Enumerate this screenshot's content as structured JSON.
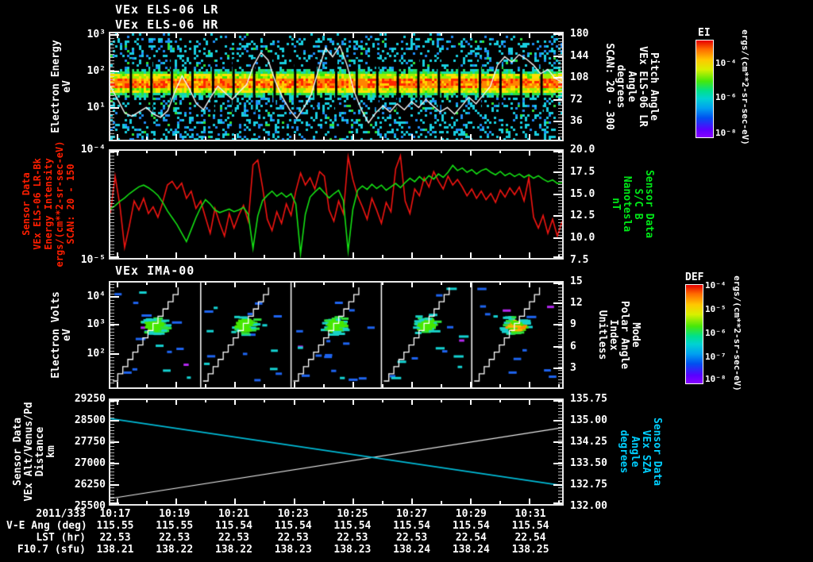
{
  "titles": {
    "line1": "VEx ELS-06 LR",
    "line2": "VEx ELS-06 HR",
    "panel3": "VEx IMA-00"
  },
  "colors": {
    "red_label": "#ff1e00",
    "green_label": "#00e818",
    "cyan_label": "#00cfff",
    "white": "#ffffff",
    "red_line": "#f01410",
    "green_line": "#14e014",
    "sza_line": "#00bcd8",
    "dist_line": "#f0f0f0"
  },
  "time_axis": {
    "date_label": "2011/333",
    "ticks": [
      "10:17",
      "10:19",
      "10:21",
      "10:23",
      "10:25",
      "10:27",
      "10:29",
      "10:31"
    ],
    "tick_fracs": [
      0.014,
      0.1444,
      0.2748,
      0.4052,
      0.5356,
      0.666,
      0.7964,
      0.9268
    ]
  },
  "panel1": {
    "left_axis": {
      "label_lines": [
        "Electron Energy",
        "eV"
      ],
      "ticks": [
        {
          "label": "10³",
          "frac": 0.022
        },
        {
          "label": "10²",
          "frac": 0.355
        },
        {
          "label": "10¹",
          "frac": 0.688
        }
      ]
    },
    "right_axis": {
      "label_lines": [
        "Pitch Angle",
        "VEx ELS-06 LR",
        "Angle",
        "degrees",
        "SCAN: 20 - 300"
      ],
      "ticks": [
        {
          "label": "180",
          "frac": 0.015
        },
        {
          "label": "144",
          "frac": 0.217
        },
        {
          "label": "108",
          "frac": 0.413
        },
        {
          "label": "72",
          "frac": 0.616
        },
        {
          "label": "36",
          "frac": 0.812
        }
      ]
    }
  },
  "panel2": {
    "left_axis": {
      "label_lines": [
        "Sensor Data",
        "VEx ELS-06 LR-Bk",
        "Energy Intensity",
        "ergs/(cm**2-sr-sec-eV)",
        "SCAN: 20 - 150"
      ],
      "ticks": [
        {
          "label": "10⁻⁴",
          "frac": 0.0
        },
        {
          "label": "10⁻⁵",
          "frac": 1.0
        }
      ]
    },
    "right_axis": {
      "label_lines": [
        "Sensor Data",
        "S/C B",
        "Nanotesla",
        "nT"
      ],
      "ticks": [
        {
          "label": "20.0",
          "frac": 0.0
        },
        {
          "label": "17.5",
          "frac": 0.2
        },
        {
          "label": "15.0",
          "frac": 0.4
        },
        {
          "label": "12.5",
          "frac": 0.6
        },
        {
          "label": "10.0",
          "frac": 0.8
        },
        {
          "label": "7.5",
          "frac": 1.0
        }
      ]
    }
  },
  "panel3": {
    "left_axis": {
      "label_lines": [
        "Electron Volts",
        "eV"
      ],
      "ticks": [
        {
          "label": "10⁴",
          "frac": 0.14
        },
        {
          "label": "10³",
          "frac": 0.4
        },
        {
          "label": "10²",
          "frac": 0.67
        }
      ]
    },
    "right_axis": {
      "label_lines": [
        "Mode",
        "Polar Angle",
        "Index",
        "Unitless"
      ],
      "ticks": [
        {
          "label": "15",
          "frac": 0.0
        },
        {
          "label": "12",
          "frac": 0.2
        },
        {
          "label": "9",
          "frac": 0.4
        },
        {
          "label": "6",
          "frac": 0.6
        },
        {
          "label": "3",
          "frac": 0.8
        }
      ]
    }
  },
  "panel4": {
    "left_axis": {
      "label_lines": [
        "Sensor Data",
        "VEx Alt/Venus/Pd",
        "Distance",
        "km"
      ],
      "ticks": [
        {
          "label": "29250",
          "frac": 0.0
        },
        {
          "label": "28500",
          "frac": 0.2
        },
        {
          "label": "27750",
          "frac": 0.4
        },
        {
          "label": "27000",
          "frac": 0.6
        },
        {
          "label": "26250",
          "frac": 0.8
        },
        {
          "label": "25500",
          "frac": 1.0
        }
      ]
    },
    "right_axis": {
      "label_lines": [
        "Sensor Data",
        "VEx SZA",
        "Angle",
        "degrees"
      ],
      "ticks": [
        {
          "label": "135.75",
          "frac": 0.0
        },
        {
          "label": "135.00",
          "frac": 0.2
        },
        {
          "label": "134.25",
          "frac": 0.4
        },
        {
          "label": "133.50",
          "frac": 0.6
        },
        {
          "label": "132.75",
          "frac": 0.8
        },
        {
          "label": "132.00",
          "frac": 1.0
        }
      ]
    }
  },
  "colorbars": [
    {
      "title": "EI",
      "unit": "ergs/(cm**2-sr-sec-eV)",
      "ticks": [
        {
          "label": "10⁻⁴",
          "frac": 0.245
        },
        {
          "label": "10⁻⁶",
          "frac": 0.6
        },
        {
          "label": "10⁻⁸",
          "frac": 0.965
        }
      ]
    },
    {
      "title": "DEF",
      "unit": "ergs/(cm**2-sr-sec-eV)",
      "ticks": [
        {
          "label": "10⁻⁴",
          "frac": 0.02
        },
        {
          "label": "10⁻⁵",
          "frac": 0.26
        },
        {
          "label": "10⁻⁶",
          "frac": 0.5
        },
        {
          "label": "10⁻⁷",
          "frac": 0.74
        },
        {
          "label": "10⁻⁸",
          "frac": 0.97
        }
      ]
    }
  ],
  "footer": {
    "rows": [
      {
        "label": "V-E Ang (deg)",
        "values": [
          "115.55",
          "115.55",
          "115.54",
          "115.54",
          "115.54",
          "115.54",
          "115.54",
          "115.54"
        ]
      },
      {
        "label": "LST (hr)",
        "values": [
          "22.53",
          "22.53",
          "22.53",
          "22.53",
          "22.53",
          "22.53",
          "22.54",
          "22.54"
        ]
      },
      {
        "label": "F10.7 (sfu)",
        "values": [
          "138.21",
          "138.22",
          "138.22",
          "138.23",
          "138.23",
          "138.24",
          "138.24",
          "138.25"
        ]
      }
    ]
  },
  "chart_data": [
    {
      "id": "els_spectrogram",
      "type": "heatmap",
      "title": "VEx ELS-06 LR / VEx ELS-06 HR",
      "ylabel": "Electron Energy (eV)",
      "y_scale": "log",
      "y_range": [
        1,
        1000
      ],
      "x_range": [
        "10:17",
        "10:32"
      ],
      "segments": 22,
      "intense_band_ev": [
        15,
        80
      ],
      "right_axis": {
        "label": "Pitch Angle, VEx ELS-06 LR, degrees, SCAN: 20 - 300",
        "range": [
          0,
          195
        ]
      },
      "colorbar": {
        "name": "EI",
        "unit": "ergs/(cm**2-sr-sec-eV)",
        "range_exp": [
          -8,
          -4
        ]
      },
      "pitch_angle_line_deg": [
        98,
        74,
        49,
        43,
        51,
        59,
        47,
        41,
        53,
        88,
        117,
        94,
        66,
        55,
        78,
        98,
        86,
        74,
        88,
        101,
        137,
        160,
        146,
        107,
        78,
        55,
        39,
        59,
        82,
        127,
        168,
        152,
        172,
        137,
        88,
        55,
        31,
        49,
        62,
        51,
        66,
        55,
        70,
        59,
        74,
        62,
        51,
        59,
        47,
        62,
        78,
        66,
        82,
        98,
        137,
        152,
        142,
        156,
        148,
        137,
        121,
        129,
        113,
        105
      ]
    },
    {
      "id": "els_intensity_and_b",
      "type": "line",
      "x_range": [
        "10:17",
        "10:32"
      ],
      "series": [
        {
          "name": "VEx ELS-06 LR-Bk Energy Intensity, SCAN: 20 - 150",
          "color": "red",
          "scale": "log",
          "unit": "ergs/(cm**2-sr-sec-eV)",
          "range": [
            1e-05,
            0.0001
          ],
          "values_1e_minus5": [
            2.6,
            5.8,
            3.1,
            1.25,
            2.0,
            3.4,
            2.8,
            3.6,
            2.6,
            3.0,
            2.4,
            3.3,
            4.8,
            5.2,
            4.4,
            5.0,
            3.6,
            4.2,
            2.9,
            3.4,
            2.4,
            1.7,
            2.9,
            2.1,
            1.6,
            2.6,
            1.9,
            2.5,
            3.1,
            2.2,
            7.4,
            8.2,
            4.6,
            2.3,
            1.8,
            2.7,
            2.1,
            3.2,
            2.5,
            4.2,
            6.2,
            4.8,
            5.6,
            4.4,
            6.4,
            5.8,
            2.8,
            2.2,
            3.4,
            2.6,
            8.8,
            5.4,
            3.8,
            3.0,
            2.3,
            3.6,
            2.8,
            2.1,
            3.3,
            2.7,
            6.8,
            9.0,
            3.4,
            2.6,
            4.4,
            3.8,
            5.6,
            4.6,
            6.4,
            5.2,
            4.4,
            5.8,
            4.8,
            5.4,
            4.6,
            3.8,
            4.4,
            3.6,
            4.2,
            3.5,
            4.0,
            3.3,
            4.3,
            3.7,
            4.5,
            3.9,
            4.6,
            3.4,
            5.6,
            2.4,
            1.9,
            2.5,
            1.7,
            2.3,
            1.6,
            2.2
          ]
        },
        {
          "name": "S/C B",
          "color": "green",
          "scale": "linear",
          "unit": "nT",
          "range": [
            7.5,
            20
          ],
          "values_nT": [
            13.2,
            13.6,
            14.1,
            14.5,
            15.0,
            15.4,
            15.8,
            16.0,
            15.7,
            15.3,
            14.8,
            14.0,
            13.0,
            12.2,
            11.4,
            10.4,
            9.4,
            10.8,
            12.2,
            13.4,
            14.3,
            13.8,
            13.1,
            12.8,
            13.0,
            13.2,
            12.9,
            13.1,
            13.4,
            12.6,
            8.6,
            12.4,
            14.2,
            14.8,
            15.3,
            14.7,
            15.1,
            14.6,
            15.0,
            13.8,
            8.0,
            12.6,
            14.6,
            15.2,
            15.7,
            15.1,
            14.5,
            15.0,
            15.4,
            14.2,
            8.3,
            13.2,
            15.4,
            15.9,
            15.5,
            16.1,
            15.6,
            16.0,
            15.4,
            15.8,
            16.2,
            15.7,
            16.3,
            16.8,
            16.4,
            17.0,
            16.5,
            17.1,
            16.7,
            17.3,
            16.9,
            17.5,
            18.3,
            17.7,
            18.0,
            17.5,
            17.8,
            17.3,
            17.7,
            17.9,
            17.5,
            17.2,
            17.6,
            17.1,
            17.4,
            17.0,
            17.3,
            16.9,
            17.2,
            16.8,
            17.1,
            16.7,
            16.4,
            16.6,
            16.2,
            16.3
          ]
        }
      ]
    },
    {
      "id": "ima_spectrogram",
      "type": "heatmap",
      "title": "VEx IMA-00",
      "ylabel": "Electron Volts (eV)",
      "y_scale": "log",
      "y_range_exp": [
        0.8,
        4.5
      ],
      "segments": 5,
      "blob_center_ev": 1000,
      "right_axis": {
        "label": "Mode / Polar Angle Index, Unitless",
        "range": [
          0,
          15
        ]
      },
      "colorbar": {
        "name": "DEF",
        "unit": "ergs/(cm**2-sr-sec-eV)",
        "range_exp": [
          -8,
          -4
        ]
      },
      "overlay": "white staircase polar-angle index line per segment"
    },
    {
      "id": "ephemeris",
      "type": "line",
      "x_range": [
        "10:17",
        "10:32"
      ],
      "series": [
        {
          "name": "VEx Alt/Venus/Pd Distance",
          "color": "white",
          "unit": "km",
          "range": [
            25500,
            29250
          ],
          "values_km": [
            25700,
            28250
          ]
        },
        {
          "name": "VEx SZA",
          "color": "cyan",
          "unit": "degrees",
          "range": [
            132.0,
            135.75
          ],
          "values_deg": [
            135.08,
            132.67
          ]
        }
      ]
    }
  ]
}
